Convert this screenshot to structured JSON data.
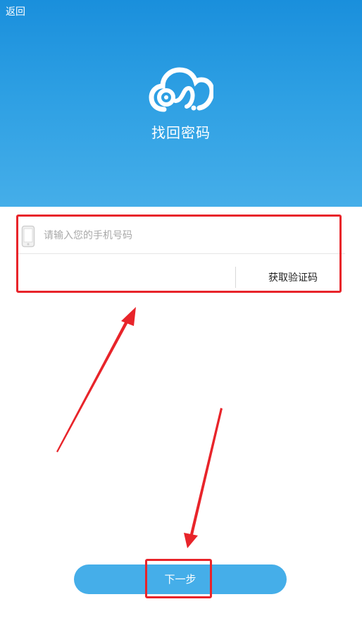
{
  "header": {
    "back_label": "返回",
    "title": "找回密码",
    "logo_icon": "cloud-logo-icon"
  },
  "form": {
    "phone_placeholder": "请输入您的手机号码",
    "phone_value": "",
    "phone_icon": "mobile-phone-icon",
    "code_value": "",
    "get_code_label": "获取验证码"
  },
  "actions": {
    "next_label": "下一步"
  },
  "colors": {
    "header_top": "#1a8fdc",
    "header_bottom": "#45aee9",
    "button": "#45aee9",
    "annotation": "#e8242a"
  }
}
